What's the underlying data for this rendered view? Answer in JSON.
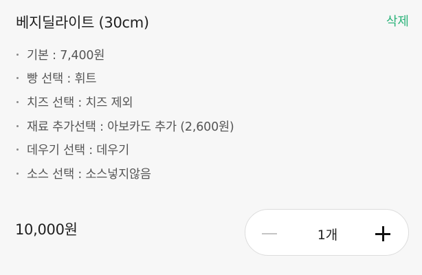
{
  "item": {
    "name": "베지딜라이트 (30cm)",
    "delete_label": "삭제",
    "options": [
      "기본 : 7,400원",
      "빵 선택 : 휘트",
      "치즈 선택 : 치즈 제외",
      "재료 추가선택 : 아보카도 추가 (2,600원)",
      "데우기 선택 : 데우기",
      "소스 선택 : 소스넣지않음"
    ],
    "price": "10,000원",
    "quantity": "1개"
  },
  "colors": {
    "accent": "#2cb37a",
    "background": "#f7f7f7",
    "text": "#1f1f1f",
    "subtext": "#555555"
  },
  "icons": {
    "decrease": "minus-icon",
    "increase": "plus-icon"
  }
}
